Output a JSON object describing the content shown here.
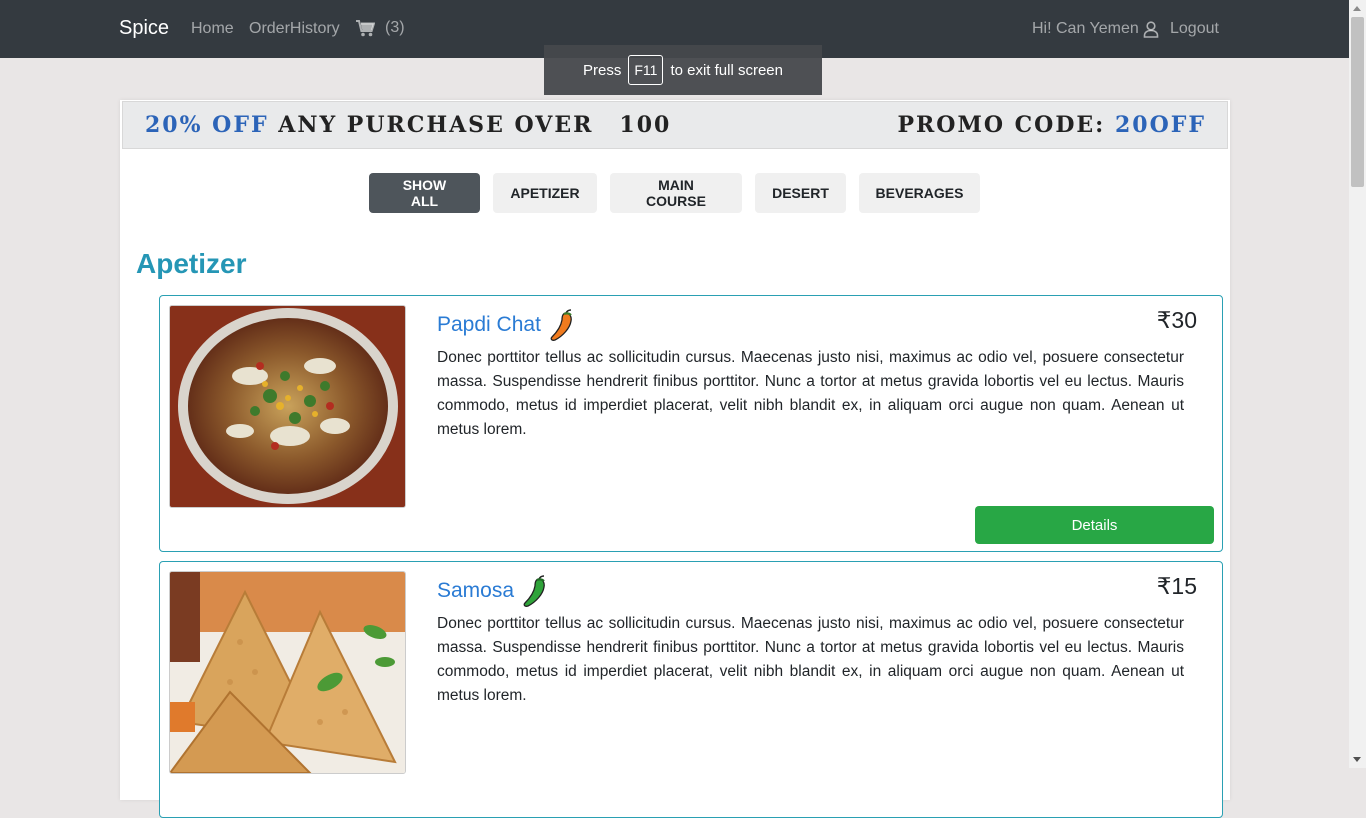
{
  "nav": {
    "brand": "Spice",
    "home": "Home",
    "order_history": "OrderHistory",
    "cart_count": "(3)",
    "greeting": "Hi! Can Yemen",
    "logout": "Logout"
  },
  "fullscreen": {
    "press": "Press",
    "key": "F11",
    "rest": "to exit full screen"
  },
  "promo": {
    "accent": "20% OFF",
    "text": "ANY PURCHASE OVER",
    "amount": "100",
    "code_label": "PROMO CODE:",
    "code": "20OFF"
  },
  "filters": [
    "SHOW ALL",
    "APETIZER",
    "MAIN COURSE",
    "DESERT",
    "BEVERAGES"
  ],
  "section_title": "Apetizer",
  "items": [
    {
      "name": "Papdi Chat",
      "price": "₹30",
      "description": "Donec porttitor tellus ac sollicitudin cursus. Maecenas justo nisi, maximus ac odio vel, posuere consectetur massa. Suspendisse hendrerit finibus porttitor. Nunc a tortor at metus gravida lobortis vel eu lectus. Mauris commodo, metus id imperdiet placerat, velit nibh blandit ex, in aliquam orci augue non quam. Aenean ut metus lorem.",
      "button": "Details",
      "spice_color": "#f07b1e"
    },
    {
      "name": "Samosa",
      "price": "₹15",
      "description": "Donec porttitor tellus ac sollicitudin cursus. Maecenas justo nisi, maximus ac odio vel, posuere consectetur massa. Suspendisse hendrerit finibus porttitor. Nunc a tortor at metus gravida lobortis vel eu lectus. Mauris commodo, metus id imperdiet placerat, velit nibh blandit ex, in aliquam orci augue non quam. Aenean ut metus lorem.",
      "spice_color": "#2fa33a"
    }
  ]
}
